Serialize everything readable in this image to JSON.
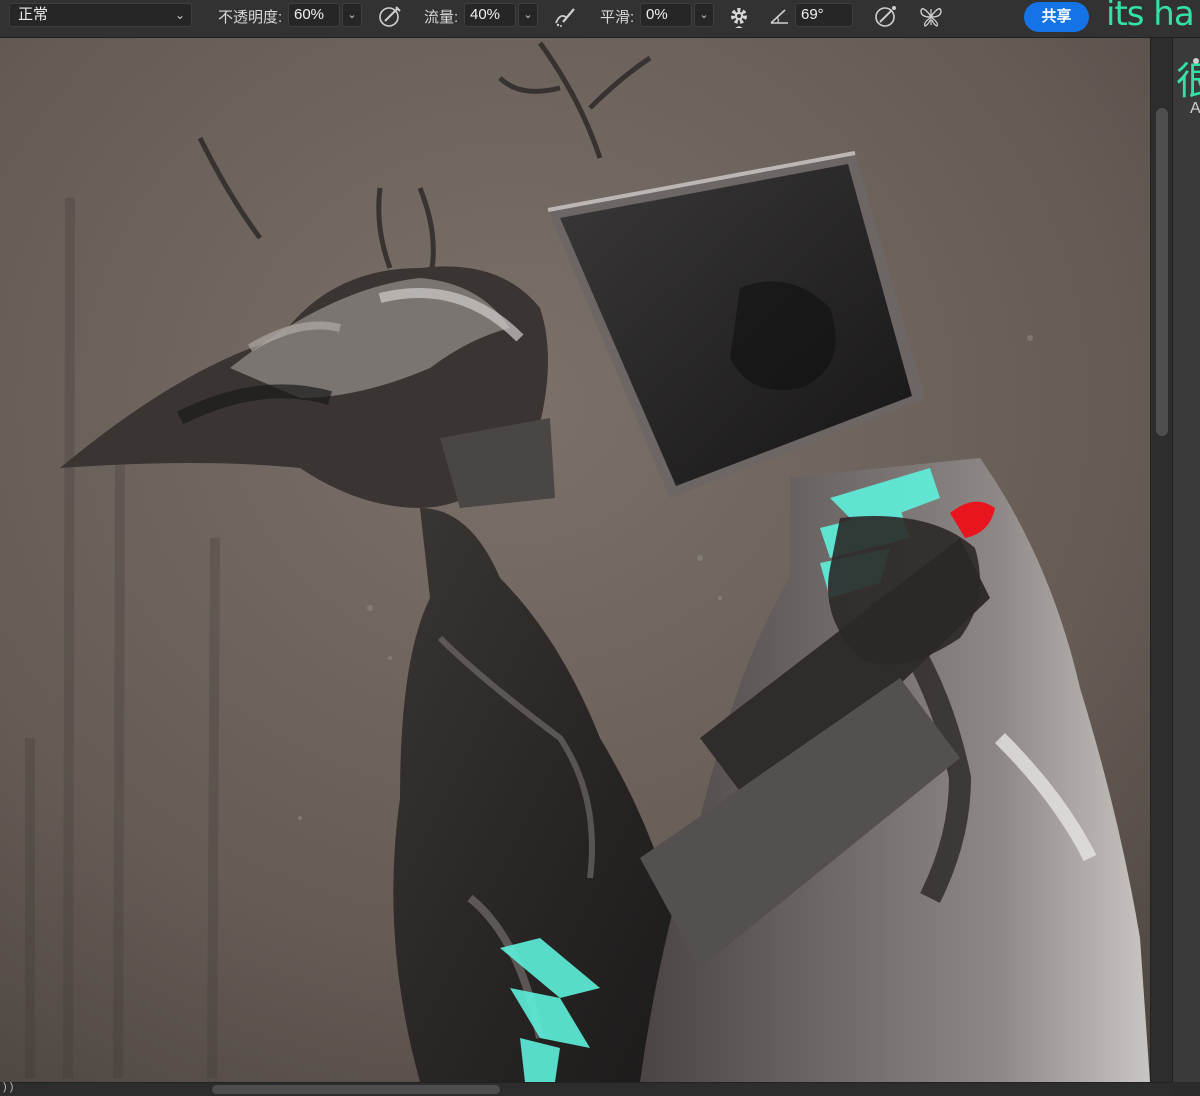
{
  "options_bar": {
    "blend_mode": "正常",
    "opacity_label": "不透明度:",
    "opacity_value": "60%",
    "flow_label": "流量:",
    "flow_value": "40%",
    "smoothing_label": "平滑:",
    "smoothing_value": "0%",
    "angle_value": "69°",
    "share_label": "共享",
    "overlay_text": "its ha"
  },
  "right_panel": {
    "glyph": "很",
    "small_text": "A"
  },
  "status_bar": {
    "text": ") )"
  },
  "colors": {
    "accent": "#1473e6",
    "overlay_teal": "#35e0a8",
    "canvas_bg": "#6a615b",
    "paint_cyan": "#5ef0dc",
    "paint_red": "#e8141e"
  },
  "icons": {
    "airbrush": "airbrush-icon",
    "airbrush_flow": "airbrush-flow-icon",
    "settings": "gear-icon",
    "angle": "angle-icon",
    "pressure_size": "pressure-icon",
    "symmetry": "butterfly-icon"
  }
}
